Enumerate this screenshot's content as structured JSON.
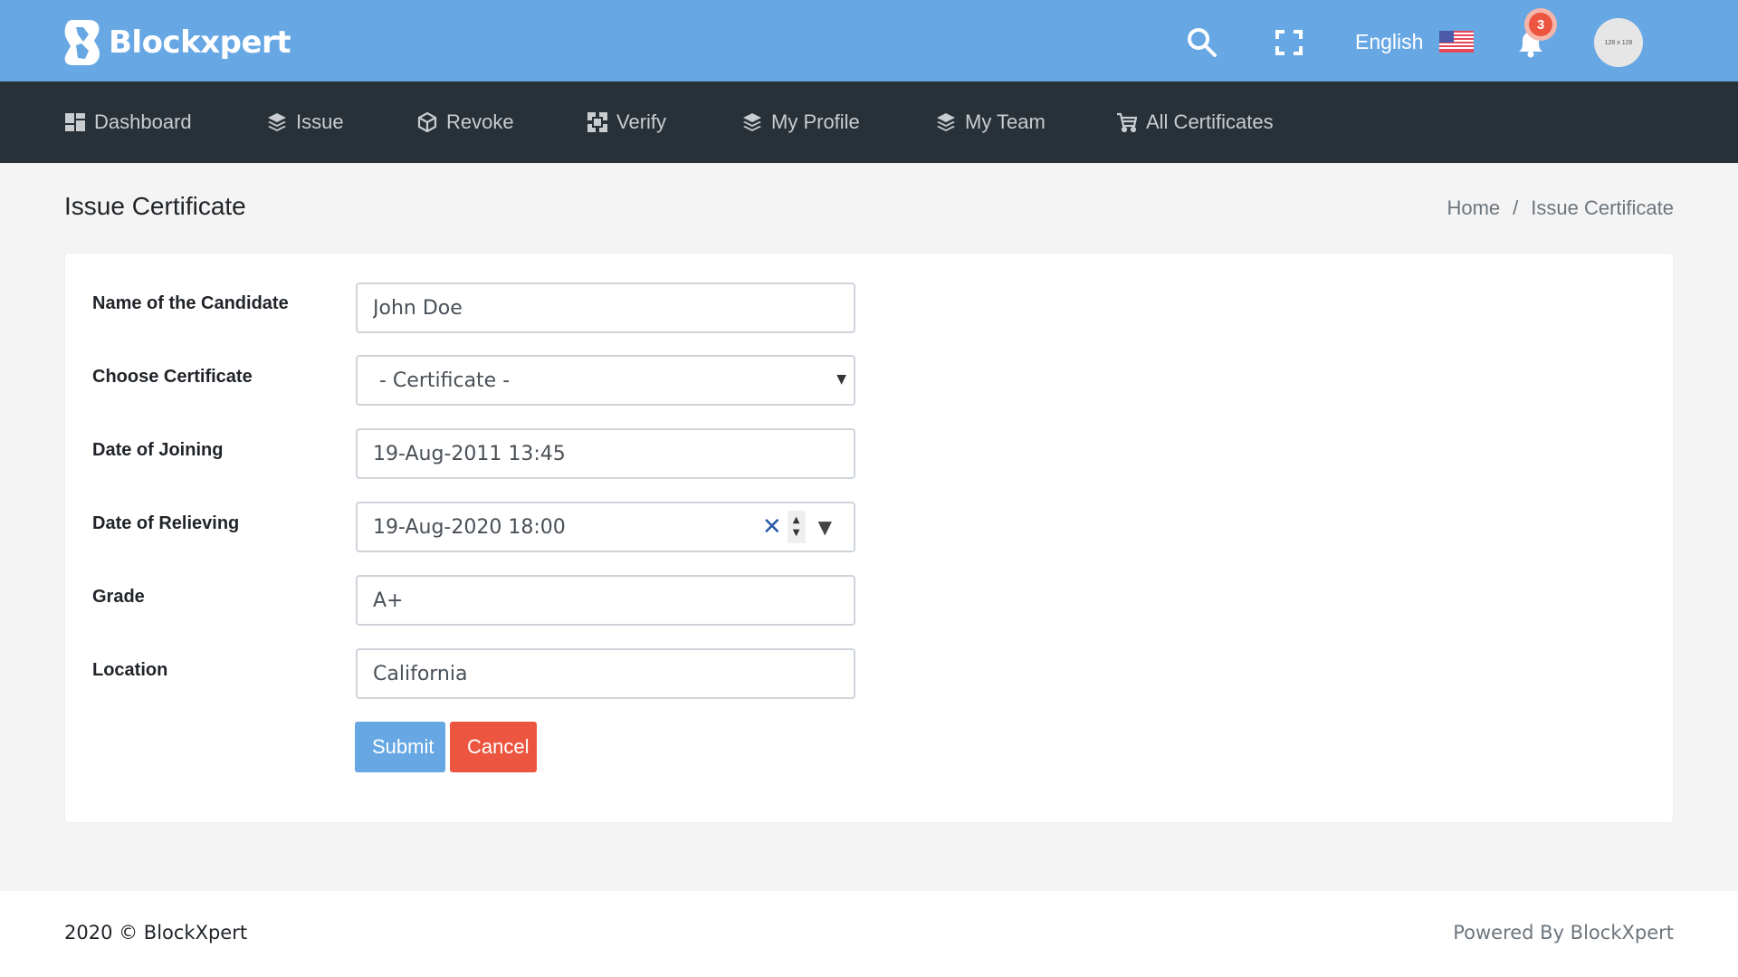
{
  "header": {
    "brand": "Blockxpert",
    "language": "English",
    "notification_count": "3",
    "avatar_placeholder": "128 x 128",
    "colors": {
      "header_bg": "#67a8e4",
      "nav_bg": "#283138",
      "badge": "#ec553f"
    }
  },
  "nav": {
    "items": [
      {
        "label": "Dashboard",
        "icon": "dashboard-icon"
      },
      {
        "label": "Issue",
        "icon": "layers-icon"
      },
      {
        "label": "Revoke",
        "icon": "cube-icon"
      },
      {
        "label": "Verify",
        "icon": "verify-icon"
      },
      {
        "label": "My Profile",
        "icon": "layers-icon"
      },
      {
        "label": "My Team",
        "icon": "layers-icon"
      },
      {
        "label": "All Certificates",
        "icon": "cart-icon"
      }
    ]
  },
  "page": {
    "title": "Issue Certificate",
    "breadcrumb": {
      "home": "Home",
      "separator": "/",
      "current": "Issue Certificate"
    }
  },
  "form": {
    "fields": {
      "name": {
        "label": "Name of the Candidate",
        "value": "John Doe"
      },
      "certificate": {
        "label": "Choose Certificate",
        "value": "- Certificate -"
      },
      "joining": {
        "label": "Date of Joining",
        "value": "19-Aug-2011 13:45"
      },
      "relieving": {
        "label": "Date of Relieving",
        "value": "19-Aug-2020 18:00"
      },
      "grade": {
        "label": "Grade",
        "value": "A+"
      },
      "location": {
        "label": "Location",
        "value": "California"
      }
    },
    "submit_label": "Submit",
    "cancel_label": "Cancel",
    "colors": {
      "submit": "#67a8e4",
      "cancel": "#ec553f"
    }
  },
  "footer": {
    "copyright": "2020 © BlockXpert",
    "powered_by": "Powered By BlockXpert"
  }
}
